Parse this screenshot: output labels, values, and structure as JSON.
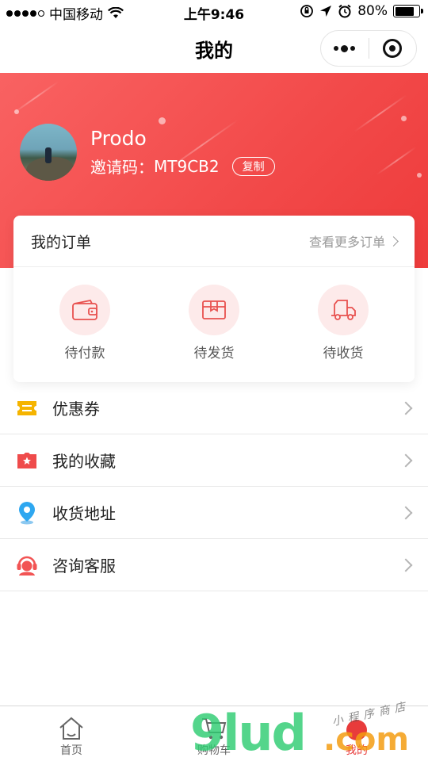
{
  "status_bar": {
    "carrier": "中国移动",
    "time": "上午9:46",
    "battery": "80%",
    "battery_level": 0.8,
    "icons": [
      "signal-dots",
      "wifi-icon",
      "orientation-lock-icon",
      "location-arrow-icon",
      "alarm-icon",
      "battery-icon"
    ]
  },
  "nav": {
    "title": "我的"
  },
  "profile": {
    "name": "Prodo",
    "invite_label": "邀请码：",
    "invite_code": "MT9CB2",
    "copy_label": "复制"
  },
  "orders": {
    "title": "我的订单",
    "more_label": "查看更多订单",
    "items": [
      {
        "label": "待付款",
        "icon": "wallet-icon"
      },
      {
        "label": "待发货",
        "icon": "package-icon"
      },
      {
        "label": "待收货",
        "icon": "truck-icon"
      }
    ]
  },
  "menu": {
    "items": [
      {
        "label": "优惠券",
        "icon": "coupon-icon",
        "color": "#f5b400"
      },
      {
        "label": "我的收藏",
        "icon": "favorite-star-icon",
        "color": "#ef4b4b"
      },
      {
        "label": "收货地址",
        "icon": "location-pin-icon",
        "color": "#2ea7f0"
      },
      {
        "label": "咨询客服",
        "icon": "customer-service-icon",
        "color": "#f25454"
      }
    ]
  },
  "tab_bar": {
    "tabs": [
      {
        "label": "首页",
        "icon": "home-icon"
      },
      {
        "label": "购物车",
        "icon": "cart-icon"
      },
      {
        "label": "我的",
        "icon": "profile-icon",
        "active": true
      }
    ]
  },
  "watermark": {
    "big": "9lud",
    "com": ".com",
    "small": "小程序商店"
  },
  "colors": {
    "accent": "#ef4545",
    "icon_red": "#e8514f",
    "icon_bg": "#fdeaea"
  }
}
